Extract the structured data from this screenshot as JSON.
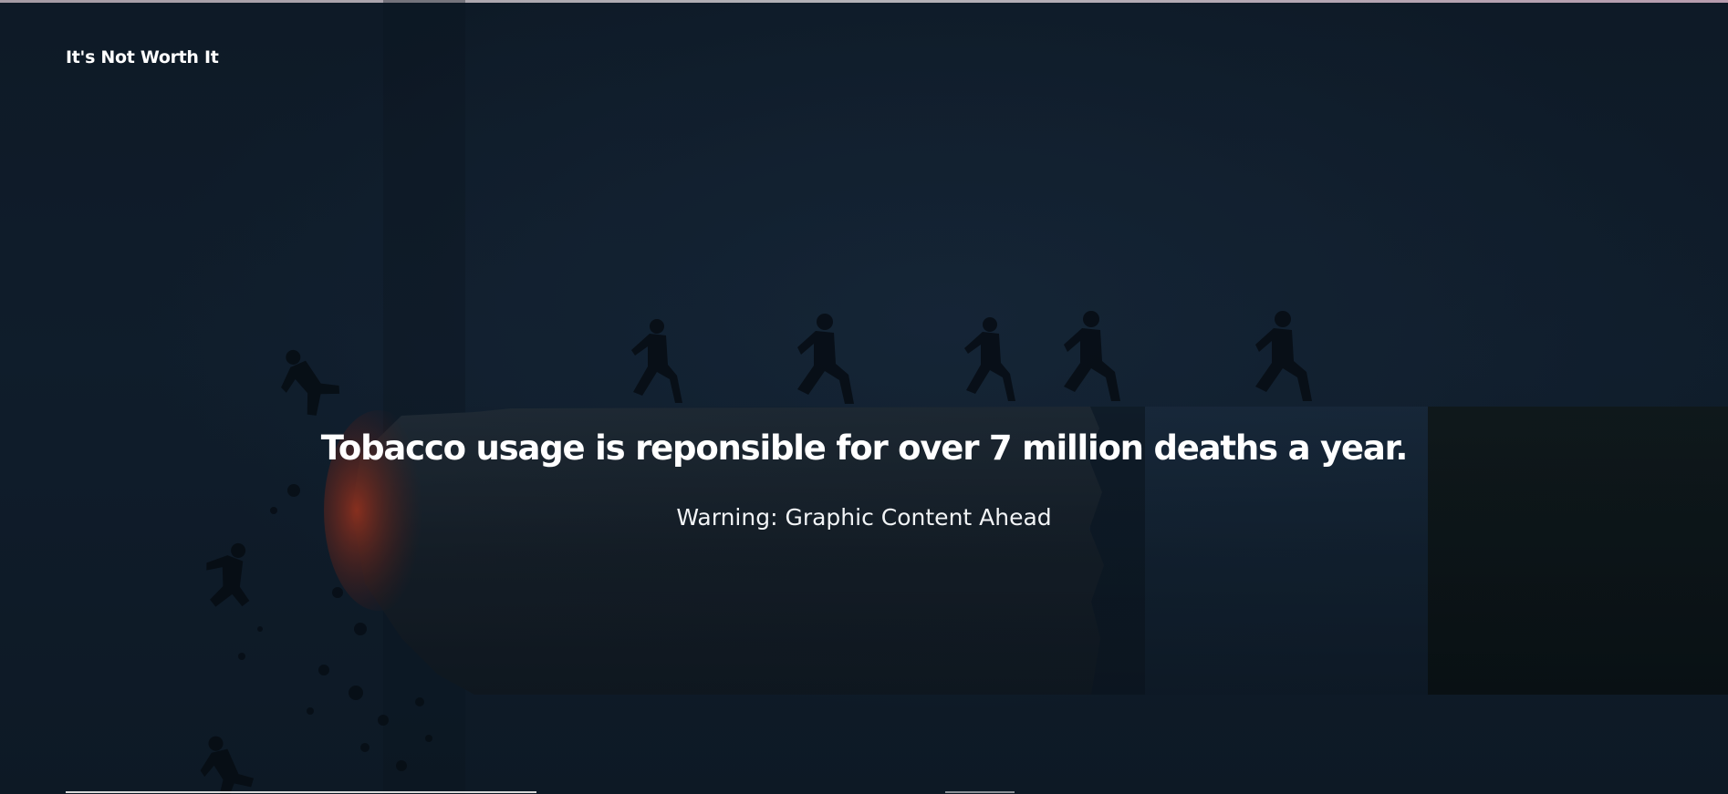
{
  "site": {
    "brand": "It's Not Worth It"
  },
  "hero": {
    "title": "Tobacco usage is reponsible for over 7 million deaths a year.",
    "subtitle": "Warning: Graphic Content Ahead"
  },
  "colors": {
    "background": "#0e1a26",
    "text": "#ffffff",
    "ember": "#b8301a",
    "filter": "#08100f"
  },
  "icons": {
    "background_art": "burning-cigarette-with-running-figures-illustration"
  }
}
